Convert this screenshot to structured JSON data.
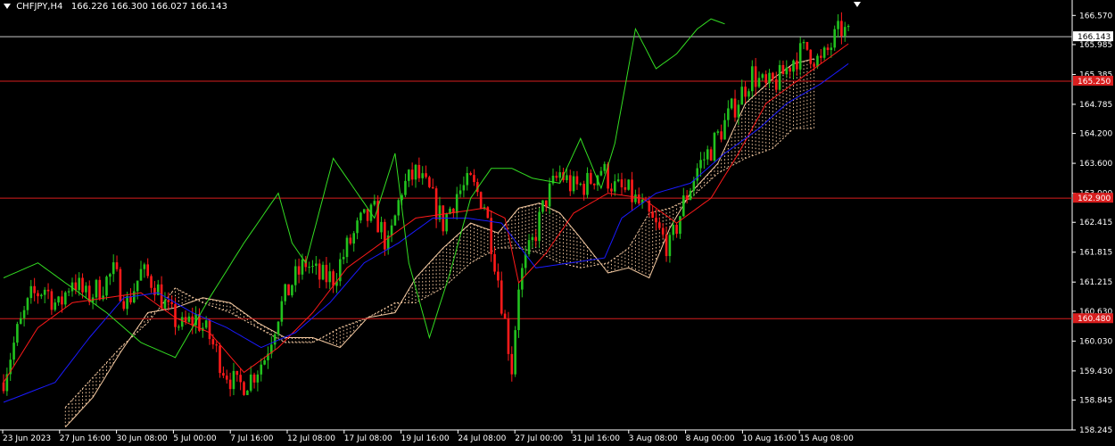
{
  "header": {
    "symbol": "CHFJPY,H4",
    "ohlc": "166.226 166.300 166.027 166.143"
  },
  "colors": {
    "background": "#000000",
    "bull": "#22c21e",
    "bear": "#ff1a1a",
    "tenkan": "#ff1a1a",
    "kijun": "#1a1aff",
    "chikou": "#33dd22",
    "cloud": "#f3c8a0",
    "hline": "#d81e1e",
    "current_line": "#c8c8c8",
    "axis_text": "#ffffff"
  },
  "chart_data": {
    "type": "candlestick",
    "symbol": "CHFJPY",
    "timeframe": "H4",
    "ylim": [
      158.245,
      166.88
    ],
    "y_ticks": [
      "166.570",
      "165.985",
      "165.385",
      "164.785",
      "164.200",
      "163.600",
      "163.000",
      "162.415",
      "161.815",
      "161.215",
      "160.630",
      "160.030",
      "159.430",
      "158.845",
      "158.245"
    ],
    "x_labels": [
      "23 Jun 2023",
      "27 Jun 16:00",
      "30 Jun 08:00",
      "5 Jul 00:00",
      "7 Jul 16:00",
      "12 Jul 08:00",
      "17 Jul 08:00",
      "19 Jul 16:00",
      "24 Jul 08:00",
      "27 Jul 00:00",
      "31 Jul 16:00",
      "3 Aug 08:00",
      "8 Aug 00:00",
      "10 Aug 16:00",
      "15 Aug 08:00"
    ],
    "current_price": "166.143",
    "horizontal_lines": [
      {
        "value": 165.25,
        "label": "165.250"
      },
      {
        "value": 162.9,
        "label": "162.900"
      },
      {
        "value": 160.48,
        "label": "160.480"
      }
    ],
    "indicators": [
      "Ichimoku Kinko Hyo"
    ],
    "close_path": [
      [
        0,
        159.3
      ],
      [
        4,
        160.2
      ],
      [
        8,
        160.9
      ],
      [
        12,
        161.1
      ],
      [
        16,
        160.7
      ],
      [
        20,
        161.3
      ],
      [
        24,
        160.9
      ],
      [
        28,
        161.1
      ],
      [
        32,
        161.4
      ],
      [
        36,
        160.8
      ],
      [
        40,
        161.4
      ],
      [
        44,
        161.2
      ],
      [
        48,
        160.6
      ],
      [
        52,
        160.3
      ],
      [
        56,
        160.5
      ],
      [
        60,
        160.1
      ],
      [
        64,
        159.5
      ],
      [
        68,
        159.1
      ],
      [
        72,
        159.3
      ],
      [
        76,
        159.7
      ],
      [
        80,
        160.6
      ],
      [
        84,
        161.2
      ],
      [
        88,
        161.6
      ],
      [
        92,
        161.3
      ],
      [
        96,
        161.3
      ],
      [
        100,
        161.9
      ],
      [
        104,
        162.4
      ],
      [
        108,
        162.6
      ],
      [
        112,
        161.9
      ],
      [
        116,
        163.1
      ],
      [
        120,
        163.4
      ],
      [
        124,
        163.0
      ],
      [
        128,
        162.4
      ],
      [
        132,
        163.0
      ],
      [
        136,
        163.2
      ],
      [
        140,
        162.8
      ],
      [
        144,
        161.3
      ],
      [
        148,
        159.5
      ],
      [
        150,
        161.2
      ],
      [
        154,
        162.0
      ],
      [
        158,
        162.9
      ],
      [
        162,
        163.4
      ],
      [
        166,
        163.1
      ],
      [
        170,
        163.2
      ],
      [
        174,
        163.5
      ],
      [
        178,
        163.1
      ],
      [
        182,
        163.0
      ],
      [
        186,
        162.7
      ],
      [
        190,
        162.3
      ],
      [
        194,
        161.9
      ],
      [
        198,
        162.8
      ],
      [
        202,
        163.5
      ],
      [
        206,
        163.9
      ],
      [
        210,
        164.4
      ],
      [
        214,
        164.9
      ],
      [
        218,
        165.4
      ],
      [
        222,
        165.1
      ],
      [
        226,
        165.3
      ],
      [
        230,
        165.7
      ],
      [
        234,
        165.9
      ],
      [
        238,
        165.6
      ],
      [
        242,
        166.1
      ],
      [
        244,
        166.3
      ],
      [
        246,
        166.143
      ]
    ],
    "tenkan_path": [
      [
        0,
        159.2
      ],
      [
        10,
        160.3
      ],
      [
        20,
        160.8
      ],
      [
        30,
        160.9
      ],
      [
        40,
        161.0
      ],
      [
        50,
        160.5
      ],
      [
        60,
        160.2
      ],
      [
        70,
        159.4
      ],
      [
        80,
        159.9
      ],
      [
        90,
        160.6
      ],
      [
        100,
        161.5
      ],
      [
        110,
        162.0
      ],
      [
        120,
        162.5
      ],
      [
        130,
        162.6
      ],
      [
        140,
        162.7
      ],
      [
        146,
        162.5
      ],
      [
        150,
        161.2
      ],
      [
        158,
        161.8
      ],
      [
        166,
        162.6
      ],
      [
        176,
        163.0
      ],
      [
        186,
        162.9
      ],
      [
        196,
        162.4
      ],
      [
        206,
        162.9
      ],
      [
        214,
        163.8
      ],
      [
        222,
        164.8
      ],
      [
        230,
        165.2
      ],
      [
        240,
        165.7
      ],
      [
        246,
        166.0
      ]
    ],
    "kijun_path": [
      [
        0,
        158.8
      ],
      [
        15,
        159.2
      ],
      [
        25,
        160.1
      ],
      [
        35,
        160.9
      ],
      [
        45,
        161.0
      ],
      [
        55,
        160.6
      ],
      [
        65,
        160.3
      ],
      [
        75,
        159.9
      ],
      [
        85,
        160.2
      ],
      [
        95,
        160.8
      ],
      [
        105,
        161.6
      ],
      [
        115,
        162.0
      ],
      [
        125,
        162.5
      ],
      [
        135,
        162.5
      ],
      [
        145,
        162.4
      ],
      [
        155,
        161.5
      ],
      [
        165,
        161.6
      ],
      [
        175,
        161.7
      ],
      [
        180,
        162.5
      ],
      [
        190,
        163.0
      ],
      [
        200,
        163.2
      ],
      [
        210,
        163.8
      ],
      [
        220,
        164.3
      ],
      [
        228,
        164.8
      ],
      [
        238,
        165.2
      ],
      [
        246,
        165.6
      ]
    ],
    "chikou_path": [
      [
        0,
        161.3
      ],
      [
        10,
        161.6
      ],
      [
        20,
        161.1
      ],
      [
        30,
        160.6
      ],
      [
        40,
        160.0
      ],
      [
        50,
        159.7
      ],
      [
        60,
        160.9
      ],
      [
        70,
        162.0
      ],
      [
        80,
        163.0
      ],
      [
        84,
        162.0
      ],
      [
        88,
        161.6
      ],
      [
        96,
        163.7
      ],
      [
        100,
        163.3
      ],
      [
        108,
        162.5
      ],
      [
        114,
        163.8
      ],
      [
        118,
        161.6
      ],
      [
        124,
        160.1
      ],
      [
        130,
        161.4
      ],
      [
        136,
        162.9
      ],
      [
        142,
        163.5
      ],
      [
        148,
        163.5
      ],
      [
        154,
        163.3
      ],
      [
        162,
        163.2
      ],
      [
        168,
        164.1
      ],
      [
        174,
        163.1
      ],
      [
        178,
        164.0
      ],
      [
        184,
        166.3
      ],
      [
        190,
        165.5
      ],
      [
        196,
        165.8
      ],
      [
        202,
        166.3
      ],
      [
        206,
        166.5
      ],
      [
        210,
        166.4
      ]
    ],
    "cloud_a_path": [
      [
        18,
        158.3
      ],
      [
        26,
        158.9
      ],
      [
        34,
        159.8
      ],
      [
        42,
        160.6
      ],
      [
        50,
        160.7
      ],
      [
        58,
        160.9
      ],
      [
        66,
        160.8
      ],
      [
        74,
        160.4
      ],
      [
        82,
        160.1
      ],
      [
        90,
        160.1
      ],
      [
        98,
        159.9
      ],
      [
        106,
        160.5
      ],
      [
        114,
        160.6
      ],
      [
        120,
        161.3
      ],
      [
        128,
        161.9
      ],
      [
        136,
        162.4
      ],
      [
        144,
        162.2
      ],
      [
        150,
        162.7
      ],
      [
        156,
        162.8
      ],
      [
        162,
        162.6
      ],
      [
        168,
        162.1
      ],
      [
        176,
        161.4
      ],
      [
        182,
        161.5
      ],
      [
        188,
        161.3
      ],
      [
        194,
        162.3
      ],
      [
        200,
        163.0
      ],
      [
        208,
        163.6
      ],
      [
        216,
        164.8
      ],
      [
        224,
        165.3
      ],
      [
        230,
        165.6
      ],
      [
        236,
        165.7
      ]
    ],
    "cloud_b_path": [
      [
        18,
        158.7
      ],
      [
        26,
        159.3
      ],
      [
        34,
        159.9
      ],
      [
        42,
        160.4
      ],
      [
        50,
        161.1
      ],
      [
        58,
        160.8
      ],
      [
        66,
        160.6
      ],
      [
        74,
        160.3
      ],
      [
        82,
        160.0
      ],
      [
        90,
        160.0
      ],
      [
        98,
        160.3
      ],
      [
        106,
        160.5
      ],
      [
        114,
        160.8
      ],
      [
        120,
        160.8
      ],
      [
        128,
        161.1
      ],
      [
        136,
        161.6
      ],
      [
        144,
        161.9
      ],
      [
        150,
        161.9
      ],
      [
        156,
        161.8
      ],
      [
        162,
        161.6
      ],
      [
        168,
        161.5
      ],
      [
        176,
        161.6
      ],
      [
        182,
        161.9
      ],
      [
        188,
        162.6
      ],
      [
        194,
        162.7
      ],
      [
        200,
        162.9
      ],
      [
        208,
        163.4
      ],
      [
        216,
        163.7
      ],
      [
        224,
        163.9
      ],
      [
        230,
        164.3
      ],
      [
        236,
        164.3
      ]
    ]
  }
}
